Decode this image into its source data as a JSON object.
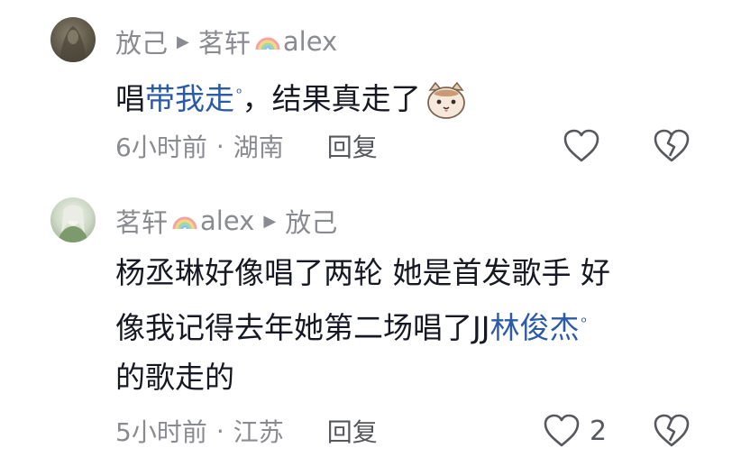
{
  "comments": [
    {
      "author": "放己",
      "reply_to": "茗轩",
      "reply_to_suffix": "alex",
      "text_prefix": "唱",
      "link_text": "带我走",
      "text_suffix": "，结果真走了",
      "time": "6小时前",
      "location": "湖南",
      "reply_label": "回复",
      "like_count": ""
    },
    {
      "author": "茗轩",
      "author_suffix": "alex",
      "reply_to": "放己",
      "line1": "杨丞琳好像唱了两轮 她是首发歌手 好",
      "line2_prefix": "像我记得去年她第二场唱了JJ",
      "link_text": "林俊杰",
      "line3": "的歌走的",
      "time": "5小时前",
      "location": "江苏",
      "reply_label": "回复",
      "like_count": "2"
    }
  ],
  "icons": {
    "reply_arrow": "play-triangle-icon",
    "rainbow": "rainbow-icon",
    "search": "search-icon",
    "emoji": "cat-face-emoji",
    "like": "heart-outline-icon",
    "dislike": "broken-heart-icon"
  },
  "colors": {
    "text": "#161823",
    "secondary": "#8a8b91",
    "link": "#2a5aa8"
  }
}
